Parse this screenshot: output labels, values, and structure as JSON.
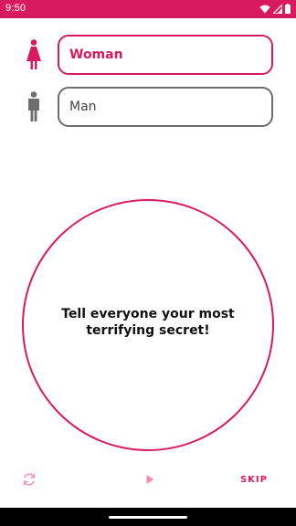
{
  "status_bar": {
    "time": "9:50",
    "icons": [
      "wifi-icon",
      "cellular-signal-icon",
      "battery-icon"
    ]
  },
  "players": [
    {
      "gender_icon": "woman-icon",
      "name": "Woman",
      "color": "#d81b60"
    },
    {
      "gender_icon": "man-icon",
      "name": "Man",
      "color": "#6d6d6d"
    }
  ],
  "card": {
    "text": "Tell everyone your most terrifying secret!"
  },
  "controls": {
    "refresh_icon": "refresh-icon",
    "play_icon": "play-icon",
    "skip_label": "SKIP"
  },
  "colors": {
    "accent": "#d81b60",
    "accent_light": "#ef8fb0",
    "neutral": "#6d6d6d"
  }
}
